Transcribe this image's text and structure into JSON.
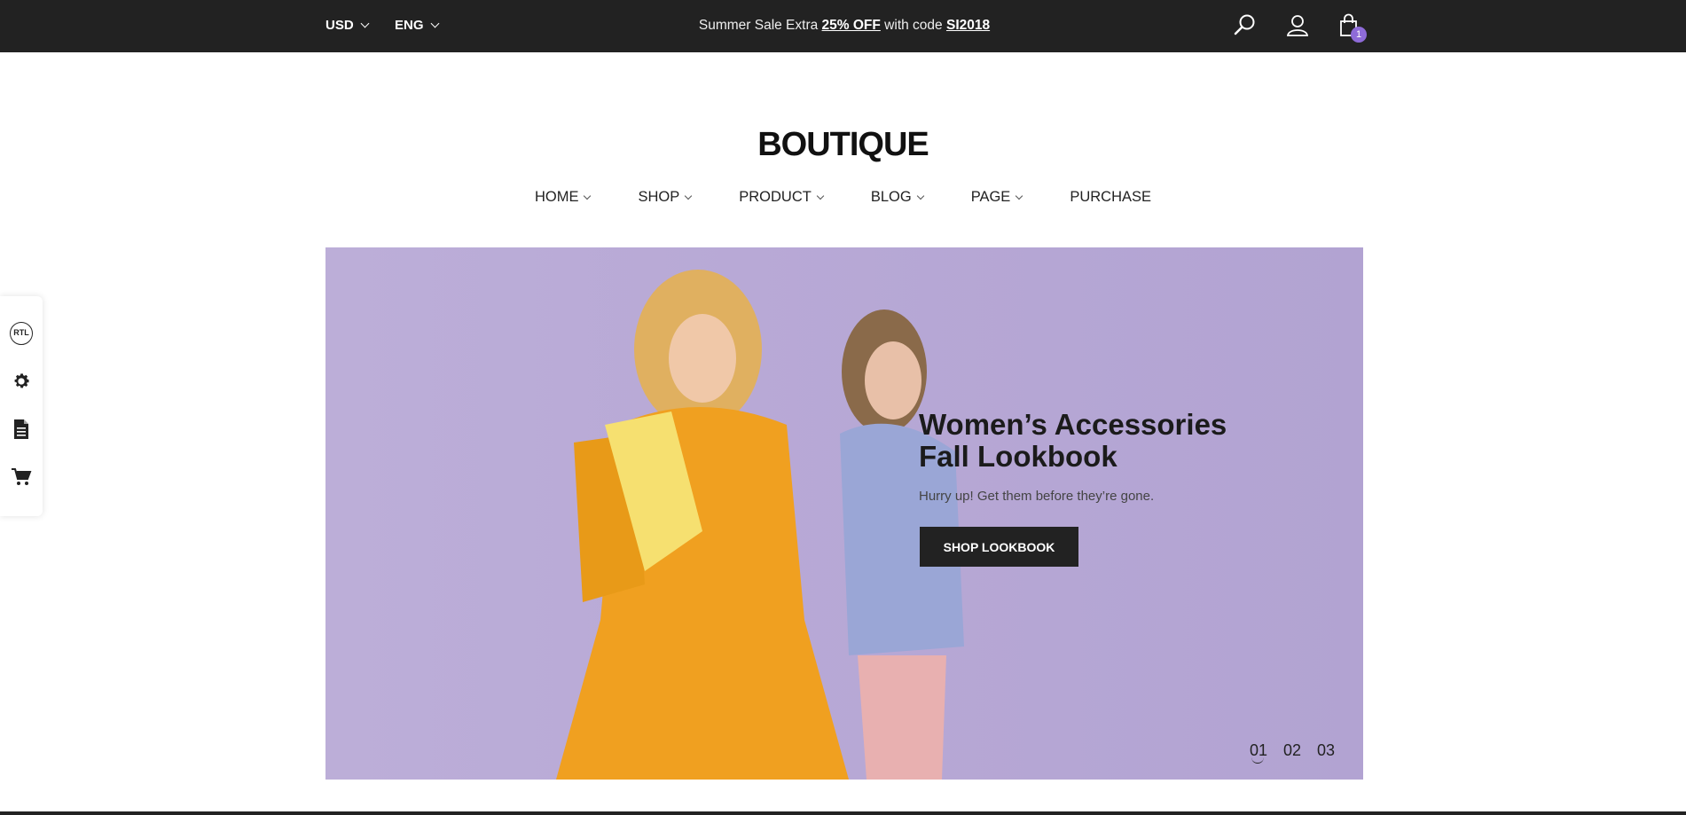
{
  "topbar": {
    "currency": "USD",
    "language": "ENG",
    "promo_prefix": "Summer Sale Extra ",
    "promo_discount": "25% OFF",
    "promo_middle": " with code ",
    "promo_code": "SI2018",
    "cart_count": "1",
    "icons": [
      "search-icon",
      "user-icon",
      "cart-bag-icon"
    ],
    "badge_color": "#8e6bd8"
  },
  "logo": "BOUTIQUE",
  "nav": {
    "items": [
      {
        "label": "HOME",
        "dropdown": true
      },
      {
        "label": "SHOP",
        "dropdown": true
      },
      {
        "label": "PRODUCT",
        "dropdown": true
      },
      {
        "label": "BLOG",
        "dropdown": true
      },
      {
        "label": "PAGE",
        "dropdown": true
      },
      {
        "label": "PURCHASE",
        "dropdown": false
      }
    ]
  },
  "sidepanel": {
    "rtl_label": "RTL",
    "icons": [
      "rtl-icon",
      "gear-icon",
      "document-icon",
      "cart-icon"
    ]
  },
  "hero": {
    "title_line1": "Women’s Accessories",
    "title_line2": "Fall Lookbook",
    "subtitle": "Hurry up! Get them before they’re gone.",
    "button": "SHOP LOOKBOOK",
    "slides": [
      "01",
      "02",
      "03"
    ],
    "active_slide": 0,
    "background": "#b8a9d6"
  }
}
